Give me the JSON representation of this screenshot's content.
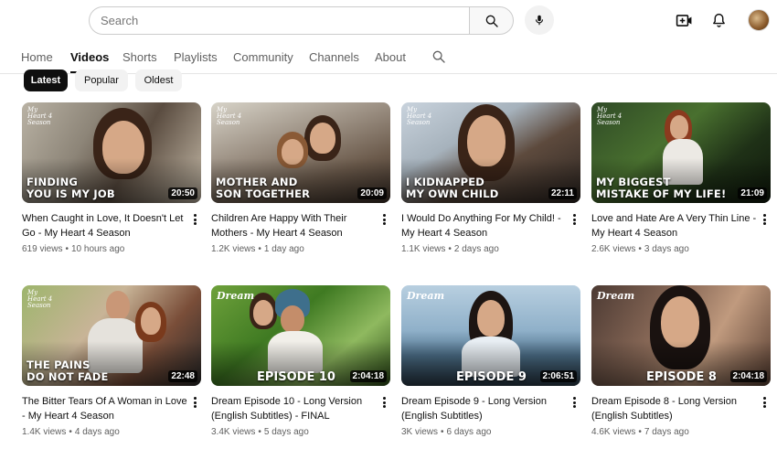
{
  "header": {
    "search_placeholder": "Search"
  },
  "tabs": [
    "Home",
    "Videos",
    "Shorts",
    "Playlists",
    "Community",
    "Channels",
    "About"
  ],
  "active_tab": "Videos",
  "chips": [
    "Latest",
    "Popular",
    "Oldest"
  ],
  "active_chip": "Latest",
  "videos": [
    {
      "title": "When Caught in Love, It Doesn't Let Go - My Heart 4 Season",
      "overlay_line1": "Finding",
      "overlay_line2": "you is my job",
      "brand": "My Heart 4 Season",
      "duration": "20:50",
      "views": "619 views",
      "age": "10 hours ago"
    },
    {
      "title": "Children Are Happy With Their Mothers - My Heart 4 Season",
      "overlay_line1": "Mother and",
      "overlay_line2": "son together",
      "brand": "My Heart 4 Season",
      "duration": "20:09",
      "views": "1.2K views",
      "age": "1 day ago"
    },
    {
      "title": "I Would Do Anything For My Child! - My Heart 4 Season",
      "overlay_line1": "I kidnapped",
      "overlay_line2": "my own child",
      "brand": "My Heart 4 Season",
      "duration": "22:11",
      "views": "1.1K views",
      "age": "2 days ago"
    },
    {
      "title": "Love and Hate Are A Very Thin Line - My Heart 4 Season",
      "overlay_line1": "My biggest",
      "overlay_line2": "mistake of my life!",
      "brand": "My Heart 4 Season",
      "duration": "21:09",
      "views": "2.6K views",
      "age": "3 days ago"
    },
    {
      "title": "The Bitter Tears Of A Woman in Love - My Heart 4 Season",
      "overlay_line1": "The pains",
      "overlay_line2": "do not fade",
      "brand": "My Heart 4 Season",
      "duration": "22:48",
      "views": "1.4K views",
      "age": "4 days ago"
    },
    {
      "title": "Dream Episode 10 - Long Version (English Subtitles) - FINAL",
      "episode": "EPISODE 10",
      "brand": "Dream",
      "duration": "2:04:18",
      "views": "3.4K views",
      "age": "5 days ago"
    },
    {
      "title": "Dream Episode 9 - Long Version (English Subtitles)",
      "episode": "EPISODE 9",
      "brand": "Dream",
      "duration": "2:06:51",
      "views": "3K views",
      "age": "6 days ago"
    },
    {
      "title": "Dream Episode 8 - Long Version (English Subtitles)",
      "episode": "EPISODE 8",
      "brand": "Dream",
      "duration": "2:04:18",
      "views": "4.6K views",
      "age": "7 days ago"
    }
  ],
  "icons": {
    "search": "search-icon",
    "mic": "microphone-icon",
    "create": "create-video-icon",
    "notifications": "bell-icon",
    "more": "more-vert-icon"
  },
  "colors": {
    "text_primary": "#0f0f0f",
    "text_secondary": "#606060",
    "chip_active_bg": "#0f0f0f",
    "chip_idle_bg": "#f2f2f2",
    "duration_bg": "#000000"
  }
}
